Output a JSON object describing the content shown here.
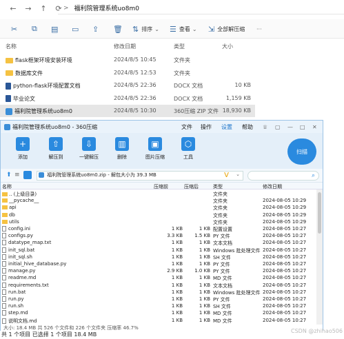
{
  "explorer": {
    "path_sep": ">",
    "path": "福利院管理系统uo8m0",
    "commands": {
      "sort": "排序",
      "view": "查看",
      "extract_all": "全部解压缩"
    },
    "columns": {
      "name": "名称",
      "modified": "修改日期",
      "type": "类型",
      "size": "大小"
    },
    "rows": [
      {
        "name": "flask框架环境安装环境",
        "date": "2024/8/5 10:45",
        "type": "文件夹",
        "size": "",
        "kind": "folder"
      },
      {
        "name": "数据库文件",
        "date": "2024/8/5 12:53",
        "type": "文件夹",
        "size": "",
        "kind": "folder"
      },
      {
        "name": "python-flask环境配置文档",
        "date": "2024/8/5 22:36",
        "type": "DOCX 文档",
        "size": "10 KB",
        "kind": "docx"
      },
      {
        "name": "毕业论文",
        "date": "2024/8/5 22:36",
        "type": "DOCX 文档",
        "size": "1,159 KB",
        "kind": "docx"
      },
      {
        "name": "福利院管理系统uo8m0",
        "date": "2024/8/5 10:30",
        "type": "360压缩 ZIP 文件",
        "size": "18,930 KB",
        "kind": "zip"
      }
    ],
    "status": "共 1 个项目  已选择 1 个项目  18.4 MB"
  },
  "zip": {
    "title": "福利院管理系统uo8m0 - 360压缩",
    "menu": [
      "文件",
      "操作",
      "设置",
      "帮助"
    ],
    "toolbar": [
      "添加",
      "解压到",
      "一键解压",
      "删除",
      "图片压缩",
      "工具"
    ],
    "scan": "扫描",
    "address": "福利院管理系统uo8m0.zip - 解包大小为 39.3 MB",
    "columns": {
      "name": "名称",
      "compressed_before": "压缩前",
      "compressed_after": "压缩后",
      "type": "类型",
      "modified": "修改日期"
    },
    "rows": [
      {
        "name": ".. (上级目录)",
        "before": "",
        "after": "",
        "type": "文件夹",
        "date": "",
        "kind": "folder"
      },
      {
        "name": "__pycache__",
        "before": "",
        "after": "",
        "type": "文件夹",
        "date": "2024-08-05 10:29",
        "kind": "folder"
      },
      {
        "name": "api",
        "before": "",
        "after": "",
        "type": "文件夹",
        "date": "2024-08-05 10:29",
        "kind": "folder"
      },
      {
        "name": "db",
        "before": "",
        "after": "",
        "type": "文件夹",
        "date": "2024-08-05 10:29",
        "kind": "folder"
      },
      {
        "name": "utils",
        "before": "",
        "after": "",
        "type": "文件夹",
        "date": "2024-08-05 10:29",
        "kind": "folder"
      },
      {
        "name": "config.ini",
        "before": "1 KB",
        "after": "1 KB",
        "type": "配置设置",
        "date": "2024-08-05 10:27",
        "kind": "file"
      },
      {
        "name": "configs.py",
        "before": "3.3 KB",
        "after": "1.5 KB",
        "type": "PY 文件",
        "date": "2024-08-05 10:27",
        "kind": "file"
      },
      {
        "name": "datatype_map.txt",
        "before": "1 KB",
        "after": "1 KB",
        "type": "文本文档",
        "date": "2024-08-05 10:27",
        "kind": "file"
      },
      {
        "name": "init_sql.bat",
        "before": "1 KB",
        "after": "1 KB",
        "type": "Windows 批处理文件",
        "date": "2024-08-05 10:27",
        "kind": "file"
      },
      {
        "name": "init_sql.sh",
        "before": "1 KB",
        "after": "1 KB",
        "type": "SH 文件",
        "date": "2024-08-05 10:27",
        "kind": "file"
      },
      {
        "name": "initial_hive_database.py",
        "before": "1 KB",
        "after": "1 KB",
        "type": "PY 文件",
        "date": "2024-08-05 10:27",
        "kind": "file"
      },
      {
        "name": "manage.py",
        "before": "2.9 KB",
        "after": "1.0 KB",
        "type": "PY 文件",
        "date": "2024-08-05 10:27",
        "kind": "file"
      },
      {
        "name": "readme.md",
        "before": "1 KB",
        "after": "1 KB",
        "type": "MD 文件",
        "date": "2024-08-05 10:27",
        "kind": "file"
      },
      {
        "name": "requirements.txt",
        "before": "1 KB",
        "after": "1 KB",
        "type": "文本文档",
        "date": "2024-08-05 10:27",
        "kind": "file"
      },
      {
        "name": "run.bat",
        "before": "1 KB",
        "after": "1 KB",
        "type": "Windows 批处理文件",
        "date": "2024-08-05 10:27",
        "kind": "file"
      },
      {
        "name": "run.py",
        "before": "1 KB",
        "after": "1 KB",
        "type": "PY 文件",
        "date": "2024-08-05 10:27",
        "kind": "file"
      },
      {
        "name": "run.sh",
        "before": "1 KB",
        "after": "1 KB",
        "type": "SH 文件",
        "date": "2024-08-05 10:27",
        "kind": "file"
      },
      {
        "name": "step.md",
        "before": "1 KB",
        "after": "1 KB",
        "type": "MD 文件",
        "date": "2024-08-05 10:27",
        "kind": "file"
      },
      {
        "name": "说明文档.md",
        "before": "1 KB",
        "after": "1 KB",
        "type": "MD 文件",
        "date": "2024-08-05 10:27",
        "kind": "file"
      }
    ],
    "status": "大小: 18.4 MB 共 526 个文件和 226 个文件夹 压缩率 46.7%"
  },
  "watermark": "CSDN @zhihao506"
}
